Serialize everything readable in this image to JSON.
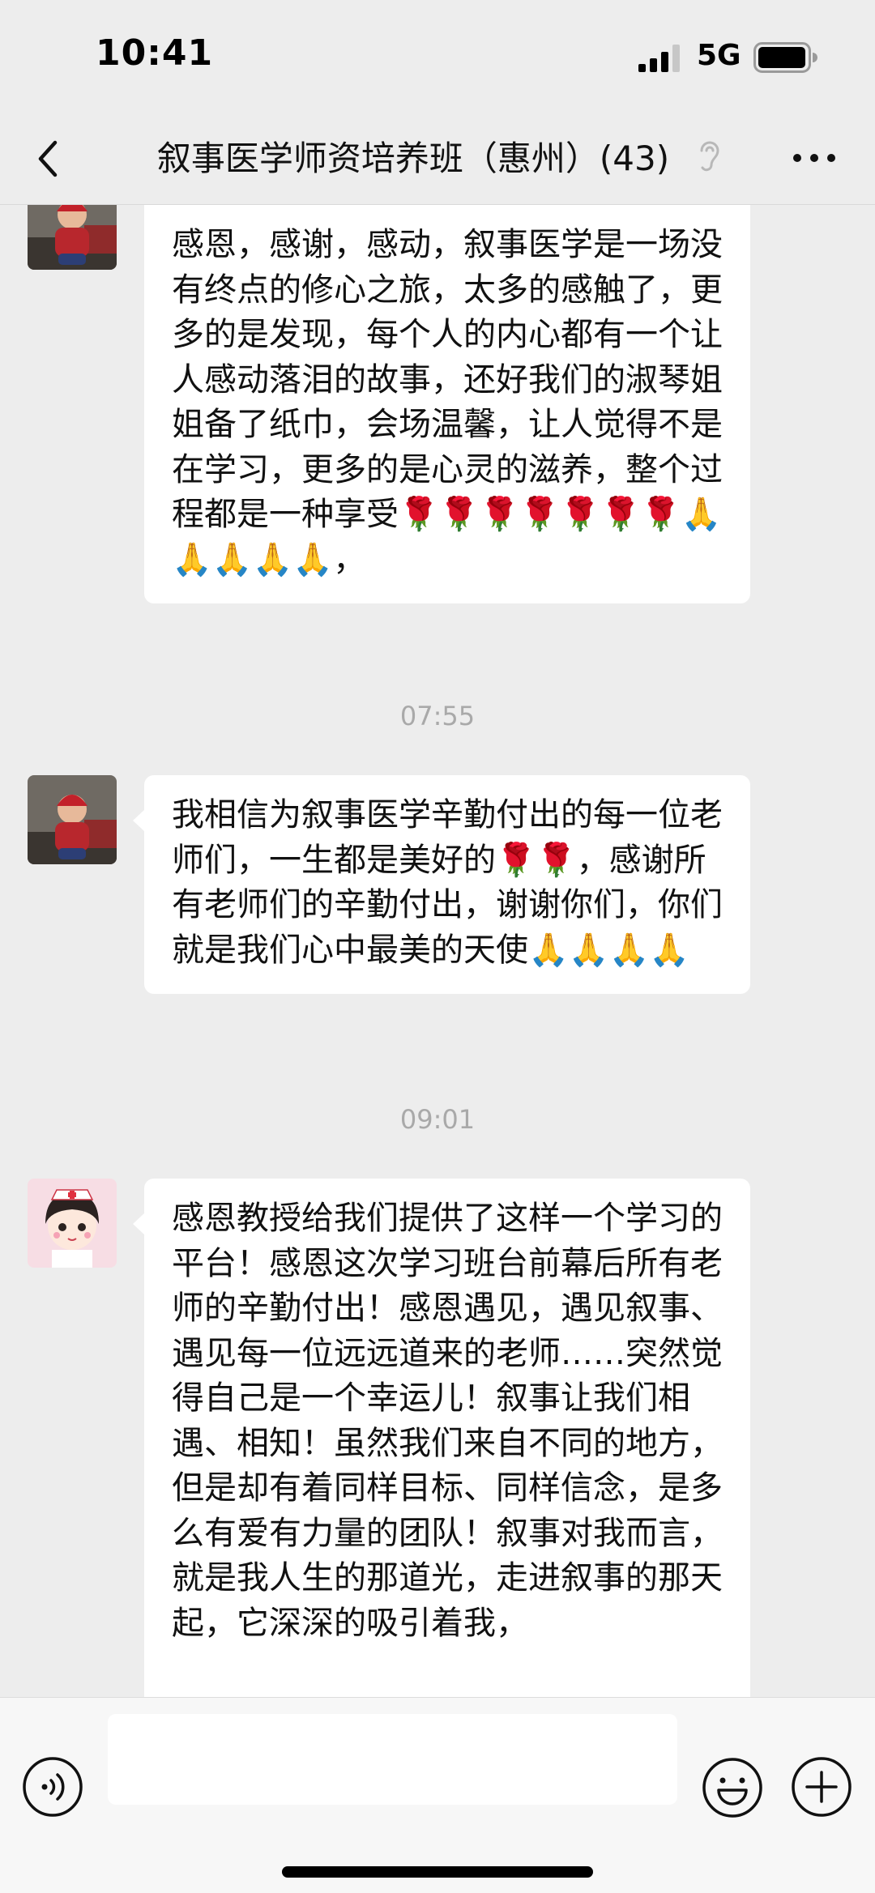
{
  "status_bar": {
    "time": "10:41",
    "network": "5G"
  },
  "nav": {
    "title": "叙事医学师资培养班（惠州）(43)",
    "back_icon": "chevron-left-icon",
    "mute_icon": "mute-icon",
    "more_icon": "more-dots-icon"
  },
  "messages": [
    {
      "avatar": "child-avatar",
      "text": "感恩，感谢，感动，叙事医学是一场没有终点的修心之旅，太多的感触了，更多的是发现，每个人的内心都有一个让人感动落泪的故事，还好我们的淑琴姐姐备了纸巾，会场温馨，让人觉得不是在学习，更多的是心灵的滋养，整个过程都是一种享受🌹🌹🌹🌹🌹🌹🌹🙏🙏🙏🙏🙏，"
    },
    {
      "time": "07:55"
    },
    {
      "avatar": "child-avatar",
      "text": "我相信为叙事医学辛勤付出的每一位老师们，一生都是美好的🌹🌹，感谢所有老师们的辛勤付出，谢谢你们，你们就是我们心中最美的天使🙏🙏🙏🙏"
    },
    {
      "time": "09:01"
    },
    {
      "avatar": "nurse-cartoon-avatar",
      "text": "感恩教授给我们提供了这样一个学习的平台！感恩这次学习班台前幕后所有老师的辛勤付出！感恩遇见，遇见叙事、遇见每一位远远道来的老师……突然觉得自己是一个幸运儿！叙事让我们相遇、相知！虽然我们来自不同的地方，但是却有着同样目标、同样信念，是多么有爱有力量的团队！叙事对我而言，就是我人生的那道光，走进叙事的那天起，它深深的吸引着我，"
    }
  ],
  "input_bar": {
    "voice_icon": "voice-icon",
    "emoji_icon": "smiley-icon",
    "plus_icon": "plus-icon",
    "input_value": ""
  }
}
